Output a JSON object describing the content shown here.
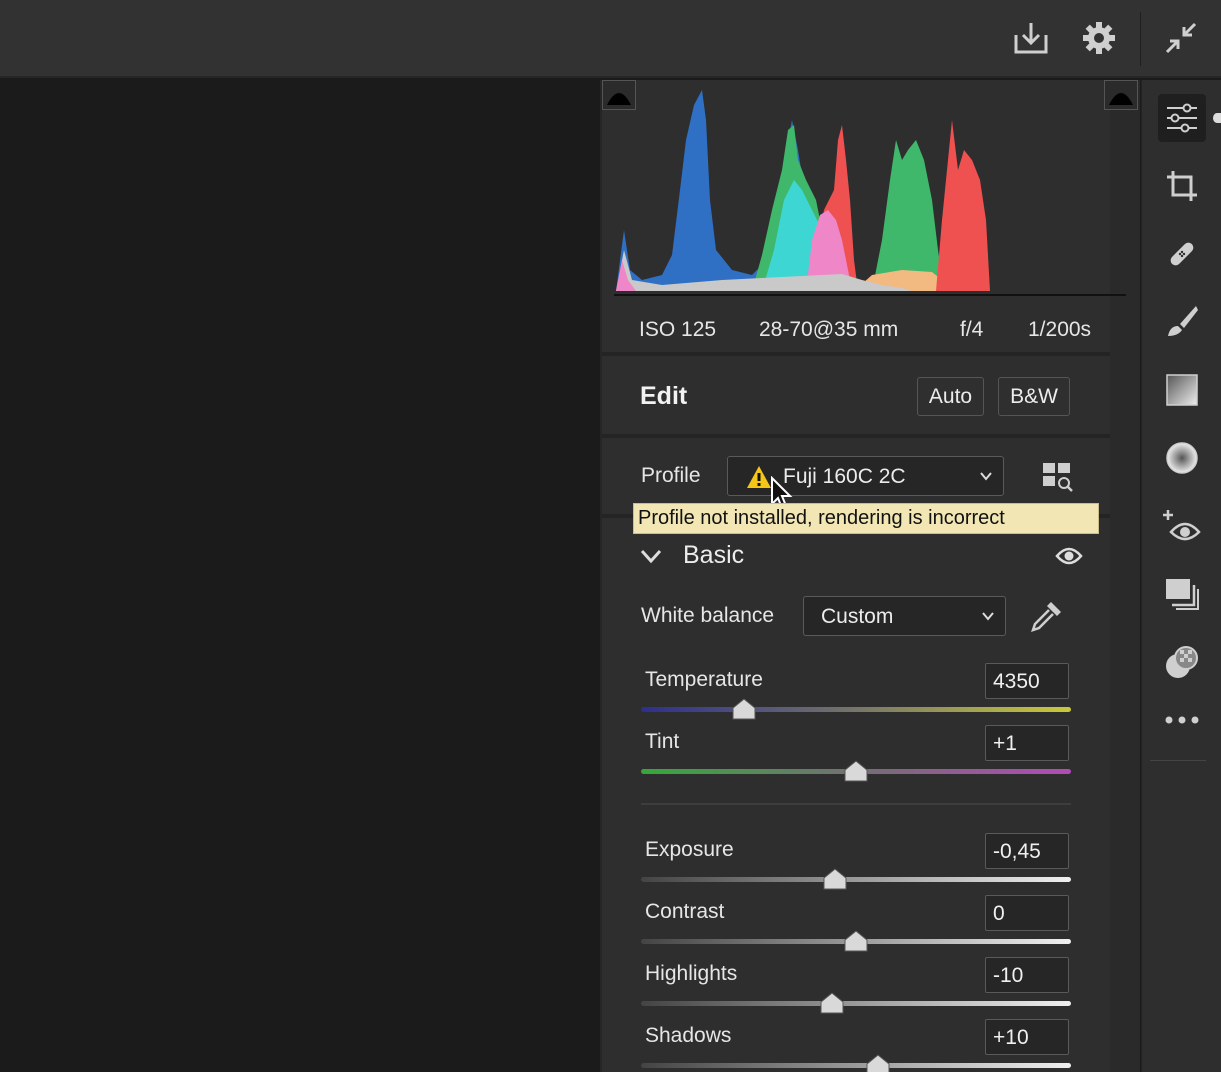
{
  "topbar": {
    "icons": [
      "save-download-icon",
      "settings-gear-icon",
      "collapse-icon"
    ]
  },
  "exif": {
    "iso": "ISO 125",
    "lens": "28-70@35 mm",
    "aperture": "f/4",
    "shutter": "1/200s"
  },
  "edit": {
    "title": "Edit",
    "auto_label": "Auto",
    "bw_label": "B&W"
  },
  "profile": {
    "label": "Profile",
    "value": "Fuji 160C 2C",
    "warning_icon": "warning-icon",
    "tooltip": "Profile not installed, rendering is incorrect"
  },
  "basic": {
    "title": "Basic",
    "white_balance": {
      "label": "White balance",
      "value": "Custom"
    },
    "sliders": [
      {
        "label": "Temperature",
        "value": "4350",
        "level": 0.24
      },
      {
        "label": "Tint",
        "value": "+1",
        "level": 0.5
      },
      {
        "label": "Exposure",
        "value": "-0,45",
        "level": 0.45
      },
      {
        "label": "Contrast",
        "value": "0",
        "level": 0.5
      },
      {
        "label": "Highlights",
        "value": "-10",
        "level": 0.445
      },
      {
        "label": "Shadows",
        "value": "+10",
        "level": 0.55
      }
    ]
  },
  "colors": {
    "panel_bg": "#2e2e2e",
    "tooltip_bg": "#f2e7b4",
    "warning": "#f5c518",
    "temp_gradient": [
      "#2d2f8f",
      "#c9c93a"
    ],
    "tint_gradient": [
      "#35a83a",
      "#b24ab8"
    ]
  },
  "toolbar": {
    "tools": [
      "edit-sliders-icon",
      "crop-icon",
      "healing-bandage-icon",
      "brush-icon",
      "linear-gradient-icon",
      "radial-gradient-icon",
      "red-eye-icon",
      "snapshots-icon",
      "presets-icon",
      "more-icon"
    ]
  }
}
